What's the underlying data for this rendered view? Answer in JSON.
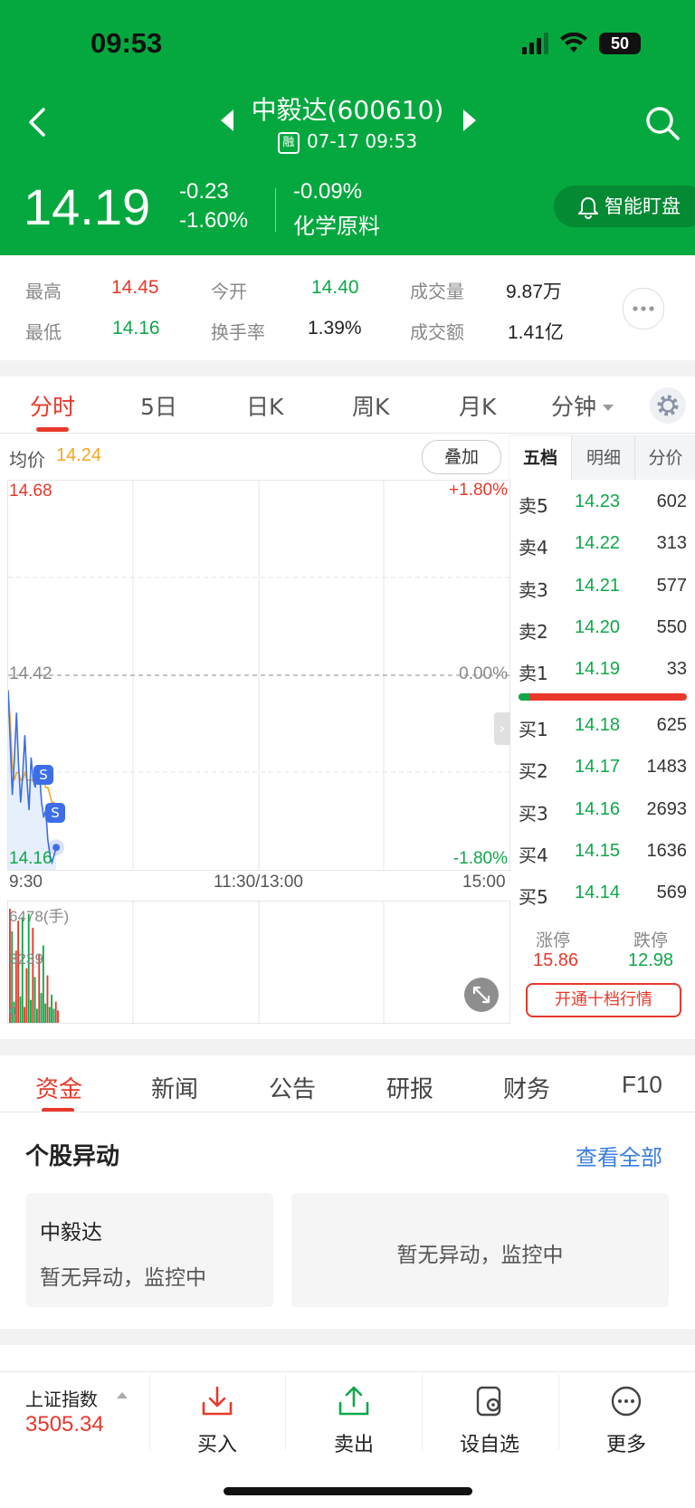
{
  "status": {
    "time": "09:53",
    "battery": "50"
  },
  "header": {
    "title": "中毅达(600610)",
    "rong_badge": "融",
    "datetime": "07-17 09:53",
    "price": "14.19",
    "change": "-0.23",
    "change_pct": "-1.60%",
    "sector_pct": "-0.09%",
    "sector": "化学原料",
    "smart_watch": "智能盯盘"
  },
  "stats": {
    "high_label": "最高",
    "high": "14.45",
    "open_label": "今开",
    "open": "14.40",
    "volume_label": "成交量",
    "volume": "9.87万",
    "low_label": "最低",
    "low": "14.16",
    "turnover_label": "换手率",
    "turnover": "1.39%",
    "amount_label": "成交额",
    "amount": "1.41亿"
  },
  "chart_tabs": [
    "分时",
    "5日",
    "日K",
    "周K",
    "月K",
    "分钟"
  ],
  "intraday": {
    "avg_label": "均价",
    "avg": "14.24",
    "overlay": "叠加",
    "y_top": "14.68",
    "y_mid": "14.42",
    "y_bot": "14.16",
    "pct_top": "+1.80%",
    "pct_mid": "0.00%",
    "pct_bot": "-1.80%",
    "x_start": "9:30",
    "x_mid": "11:30/13:00",
    "x_end": "15:00",
    "vol_top": "6478(手)",
    "vol_mid": "3239",
    "vol_zero": "0",
    "marker": "S"
  },
  "chart_data": {
    "type": "line",
    "x": [
      "9:30",
      "9:31",
      "9:32",
      "9:33",
      "9:34",
      "9:35",
      "9:36",
      "9:37",
      "9:38",
      "9:39",
      "9:40",
      "9:41",
      "9:42",
      "9:43",
      "9:44",
      "9:45",
      "9:46",
      "9:47",
      "9:48",
      "9:49",
      "9:50",
      "9:51",
      "9:52",
      "9:53"
    ],
    "series": [
      {
        "values": [
          14.4,
          14.33,
          14.26,
          14.31,
          14.37,
          14.3,
          14.25,
          14.29,
          14.34,
          14.28,
          14.24,
          14.31,
          14.28,
          14.27,
          14.3,
          14.29,
          14.25,
          14.23,
          14.24,
          14.2,
          14.18,
          14.17,
          14.18,
          14.19
        ]
      },
      {
        "values": [
          14.4,
          14.36,
          14.3,
          14.28,
          14.29,
          14.29,
          14.28,
          14.28,
          14.29,
          14.28,
          14.28,
          14.28,
          14.28,
          14.28,
          14.28,
          14.28,
          14.28,
          14.28,
          14.27,
          14.27,
          14.26,
          14.25,
          14.25,
          14.24
        ]
      }
    ],
    "volume": [
      6478,
      5200,
      1200,
      4100,
      5800,
      1500,
      6000,
      900,
      3100,
      6200,
      1300,
      5400,
      2600,
      800,
      3900,
      1700,
      4400,
      1100,
      2700,
      900,
      1600,
      800,
      1200,
      700
    ],
    "ylim": [
      14.16,
      14.68
    ],
    "volume_ylim": [
      0,
      6478
    ]
  },
  "orderbook": {
    "tabs": [
      "五档",
      "明细",
      "分价"
    ],
    "sells": [
      {
        "label": "卖5",
        "price": "14.23",
        "vol": "602"
      },
      {
        "label": "卖4",
        "price": "14.22",
        "vol": "313"
      },
      {
        "label": "卖3",
        "price": "14.21",
        "vol": "577"
      },
      {
        "label": "卖2",
        "price": "14.20",
        "vol": "550"
      },
      {
        "label": "卖1",
        "price": "14.19",
        "vol": "33"
      }
    ],
    "buys": [
      {
        "label": "买1",
        "price": "14.18",
        "vol": "625"
      },
      {
        "label": "买2",
        "price": "14.17",
        "vol": "1483"
      },
      {
        "label": "买3",
        "price": "14.16",
        "vol": "2693"
      },
      {
        "label": "买4",
        "price": "14.15",
        "vol": "1636"
      },
      {
        "label": "买5",
        "price": "14.14",
        "vol": "569"
      }
    ],
    "limit_up_label": "涨停",
    "limit_up": "15.86",
    "limit_down_label": "跌停",
    "limit_down": "12.98",
    "ten_level_button": "开通十档行情"
  },
  "section_tabs": [
    "资金",
    "新闻",
    "公告",
    "研报",
    "财务",
    "F10"
  ],
  "alerts": {
    "title": "个股异动",
    "view_all": "查看全部",
    "card_name": "中毅达",
    "card_text": "暂无异动，监控中",
    "right_text": "暂无异动，监控中"
  },
  "bottom": {
    "index_name": "上证指数",
    "index_value": "3505.34",
    "buy": "买入",
    "sell": "卖出",
    "watchlist": "设自选",
    "more": "更多"
  },
  "colors": {
    "green_header": "#05a83e",
    "up": "#e8382b",
    "down": "#0ea84a",
    "avg_line": "#f5a623",
    "link": "#3b7ddd"
  }
}
